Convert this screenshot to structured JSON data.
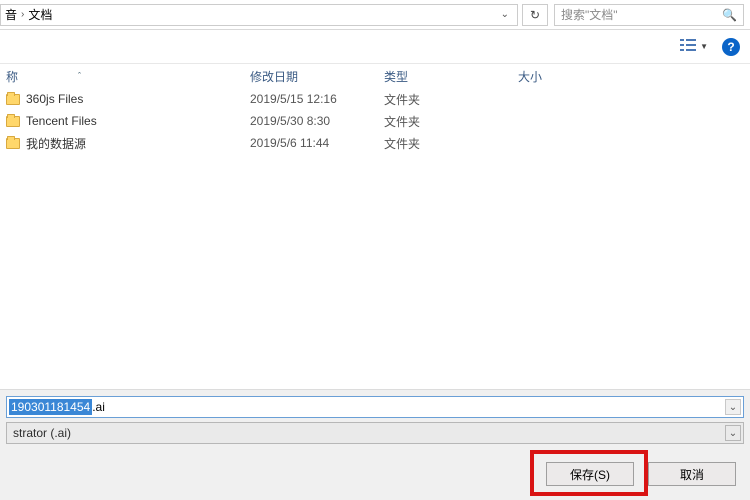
{
  "breadcrumb": {
    "prefix_fragment": "音",
    "current": "文档"
  },
  "search": {
    "placeholder": "搜索\"文档\""
  },
  "columns": {
    "name": "称",
    "date": "修改日期",
    "type": "类型",
    "size": "大小"
  },
  "files": [
    {
      "name": "360js Files",
      "date": "2019/5/15 12:16",
      "type": "文件夹"
    },
    {
      "name": "Tencent Files",
      "date": "2019/5/30 8:30",
      "type": "文件夹"
    },
    {
      "name": "我的数据源",
      "date": "2019/5/6 11:44",
      "type": "文件夹"
    }
  ],
  "filename": {
    "selected_fragment": "190301181454",
    "extension": ".ai"
  },
  "filetype": {
    "selected_fragment": "strator (.ai)"
  },
  "buttons": {
    "save": "保存(S)",
    "cancel": "取消"
  }
}
